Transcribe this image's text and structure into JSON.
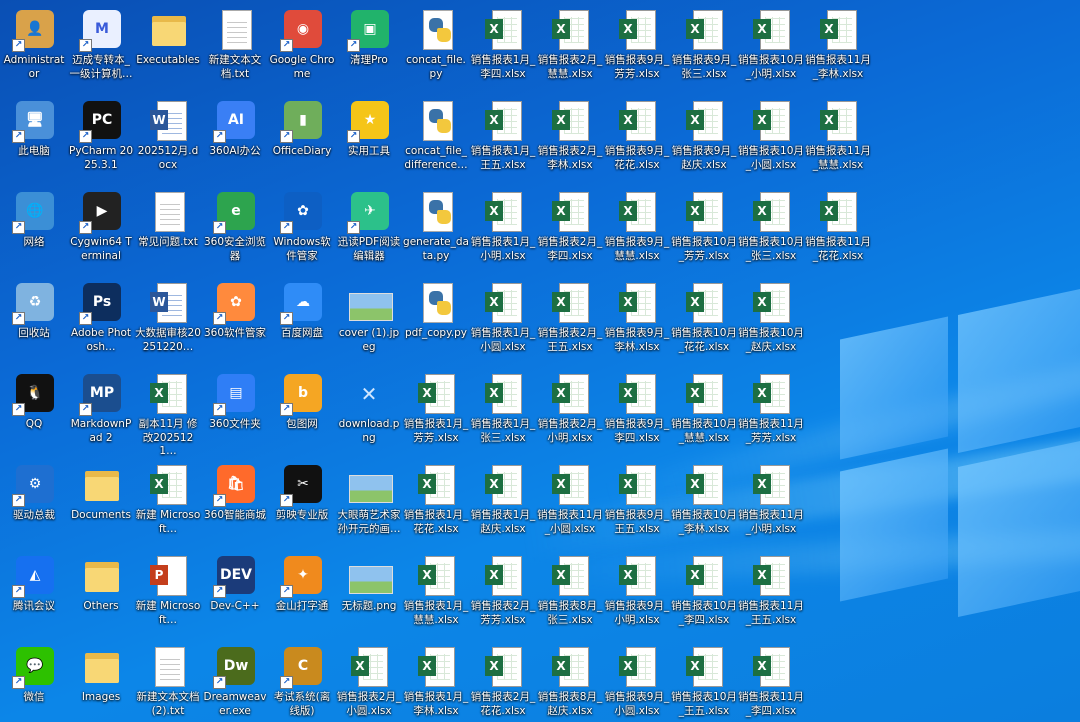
{
  "desktop": {
    "columns": [
      {
        "icons": [
          {
            "label": "Administrator",
            "kind": "user"
          },
          {
            "label": "此电脑",
            "kind": "pc"
          },
          {
            "label": "网络",
            "kind": "network"
          },
          {
            "label": "回收站",
            "kind": "recycle"
          },
          {
            "label": "QQ",
            "kind": "qq"
          },
          {
            "label": "驱动总裁",
            "kind": "driver"
          },
          {
            "label": "腾讯会议",
            "kind": "meeting"
          },
          {
            "label": "微信",
            "kind": "wechat"
          }
        ]
      },
      {
        "icons": [
          {
            "label": "迈成专转本_一级计算机…",
            "kind": "mc"
          },
          {
            "label": "PyCharm 2025.3.1",
            "kind": "pycharm"
          },
          {
            "label": "Cygwin64 Terminal",
            "kind": "terminal"
          },
          {
            "label": "Adobe Photosh…",
            "kind": "photoshop"
          },
          {
            "label": "MarkdownPad 2",
            "kind": "markdown"
          },
          {
            "label": "Documents",
            "kind": "folder"
          },
          {
            "label": "Others",
            "kind": "folder"
          },
          {
            "label": "Images",
            "kind": "folder"
          }
        ]
      },
      {
        "icons": [
          {
            "label": "Executables",
            "kind": "folder"
          },
          {
            "label": "202512月.docx",
            "kind": "word"
          },
          {
            "label": "常见问题.txt",
            "kind": "doc"
          },
          {
            "label": "大数据审核20251220…",
            "kind": "word"
          },
          {
            "label": "副本11月 修改2025121…",
            "kind": "excel"
          },
          {
            "label": "新建 Microsoft…",
            "kind": "excel"
          },
          {
            "label": "新建 Microsoft…",
            "kind": "ppt"
          },
          {
            "label": "新建文本文档 (2).txt",
            "kind": "doc"
          }
        ]
      },
      {
        "icons": [
          {
            "label": "新建文本文档.txt",
            "kind": "doc"
          },
          {
            "label": "360AI办公",
            "kind": "ai360"
          },
          {
            "label": "360安全浏览器",
            "kind": "browser360"
          },
          {
            "label": "360软件管家",
            "kind": "soft360"
          },
          {
            "label": "360文件夹",
            "kind": "folder360"
          },
          {
            "label": "360智能商城",
            "kind": "mall360"
          },
          {
            "label": "Dev-C++",
            "kind": "devcpp"
          },
          {
            "label": "Dreamweaver.exe",
            "kind": "dw"
          }
        ]
      },
      {
        "icons": [
          {
            "label": "Google Chrome",
            "kind": "chrome"
          },
          {
            "label": "OfficeDiary",
            "kind": "diary"
          },
          {
            "label": "Windows软件管家",
            "kind": "winsoft"
          },
          {
            "label": "百度网盘",
            "kind": "baidu"
          },
          {
            "label": "包图网",
            "kind": "baotu"
          },
          {
            "label": "剪映专业版",
            "kind": "capcut"
          },
          {
            "label": "金山打字通",
            "kind": "typing"
          },
          {
            "label": "考试系统(离线版)",
            "kind": "exam"
          }
        ]
      },
      {
        "icons": [
          {
            "label": "清理Pro",
            "kind": "cleaner"
          },
          {
            "label": "实用工具",
            "kind": "star"
          },
          {
            "label": "迅读PDF阅读编辑器",
            "kind": "pdfreader"
          },
          {
            "label": "cover (1).jpeg",
            "kind": "image"
          },
          {
            "label": "download.png",
            "kind": "broken"
          },
          {
            "label": "大眼萌艺术家孙开元的画…",
            "kind": "image"
          },
          {
            "label": "无标题.png",
            "kind": "image"
          },
          {
            "label": "销售报表2月_小圆.xlsx",
            "kind": "excel"
          }
        ]
      },
      {
        "icons": [
          {
            "label": "concat_file.py",
            "kind": "python"
          },
          {
            "label": "concat_file_difference…",
            "kind": "python"
          },
          {
            "label": "generate_data.py",
            "kind": "python"
          },
          {
            "label": "pdf_copy.py",
            "kind": "python"
          },
          {
            "label": "销售报表1月_芳芳.xlsx",
            "kind": "excel"
          },
          {
            "label": "销售报表1月_花花.xlsx",
            "kind": "excel"
          },
          {
            "label": "销售报表1月_慧慧.xlsx",
            "kind": "excel"
          },
          {
            "label": "销售报表1月_李林.xlsx",
            "kind": "excel"
          }
        ]
      },
      {
        "icons": [
          {
            "label": "销售报表1月_李四.xlsx",
            "kind": "excel"
          },
          {
            "label": "销售报表1月_王五.xlsx",
            "kind": "excel"
          },
          {
            "label": "销售报表1月_小明.xlsx",
            "kind": "excel"
          },
          {
            "label": "销售报表1月_小圆.xlsx",
            "kind": "excel"
          },
          {
            "label": "销售报表1月_张三.xlsx",
            "kind": "excel"
          },
          {
            "label": "销售报表1月_赵庆.xlsx",
            "kind": "excel"
          },
          {
            "label": "销售报表2月_芳芳.xlsx",
            "kind": "excel"
          },
          {
            "label": "销售报表2月_花花.xlsx",
            "kind": "excel"
          }
        ]
      },
      {
        "icons": [
          {
            "label": "销售报表2月_慧慧.xlsx",
            "kind": "excel"
          },
          {
            "label": "销售报表2月_李林.xlsx",
            "kind": "excel"
          },
          {
            "label": "销售报表2月_李四.xlsx",
            "kind": "excel"
          },
          {
            "label": "销售报表2月_王五.xlsx",
            "kind": "excel"
          },
          {
            "label": "销售报表2月_小明.xlsx",
            "kind": "excel"
          },
          {
            "label": "销售报表11月_小圆.xlsx",
            "kind": "excel"
          },
          {
            "label": "销售报表8月_张三.xlsx",
            "kind": "excel"
          },
          {
            "label": "销售报表8月_赵庆.xlsx",
            "kind": "excel"
          }
        ]
      },
      {
        "icons": [
          {
            "label": "销售报表9月_芳芳.xlsx",
            "kind": "excel"
          },
          {
            "label": "销售报表9月_花花.xlsx",
            "kind": "excel"
          },
          {
            "label": "销售报表9月_慧慧.xlsx",
            "kind": "excel"
          },
          {
            "label": "销售报表9月_李林.xlsx",
            "kind": "excel"
          },
          {
            "label": "销售报表9月_李四.xlsx",
            "kind": "excel"
          },
          {
            "label": "销售报表9月_王五.xlsx",
            "kind": "excel"
          },
          {
            "label": "销售报表9月_小明.xlsx",
            "kind": "excel"
          },
          {
            "label": "销售报表9月_小圆.xlsx",
            "kind": "excel"
          }
        ]
      },
      {
        "icons": [
          {
            "label": "销售报表9月_张三.xlsx",
            "kind": "excel"
          },
          {
            "label": "销售报表9月_赵庆.xlsx",
            "kind": "excel"
          },
          {
            "label": "销售报表10月_芳芳.xlsx",
            "kind": "excel"
          },
          {
            "label": "销售报表10月_花花.xlsx",
            "kind": "excel"
          },
          {
            "label": "销售报表10月_慧慧.xlsx",
            "kind": "excel"
          },
          {
            "label": "销售报表10月_李林.xlsx",
            "kind": "excel"
          },
          {
            "label": "销售报表10月_李四.xlsx",
            "kind": "excel"
          },
          {
            "label": "销售报表10月_王五.xlsx",
            "kind": "excel"
          }
        ]
      },
      {
        "icons": [
          {
            "label": "销售报表10月_小明.xlsx",
            "kind": "excel"
          },
          {
            "label": "销售报表10月_小圆.xlsx",
            "kind": "excel"
          },
          {
            "label": "销售报表10月_张三.xlsx",
            "kind": "excel"
          },
          {
            "label": "销售报表10月_赵庆.xlsx",
            "kind": "excel"
          },
          {
            "label": "销售报表11月_芳芳.xlsx",
            "kind": "excel"
          },
          {
            "label": "销售报表11月_小明.xlsx",
            "kind": "excel"
          },
          {
            "label": "销售报表11月_王五.xlsx",
            "kind": "excel"
          },
          {
            "label": "销售报表11月_李四.xlsx",
            "kind": "excel"
          }
        ]
      },
      {
        "icons": [
          {
            "label": "销售报表11月_李林.xlsx",
            "kind": "excel"
          },
          {
            "label": "销售报表11月_慧慧.xlsx",
            "kind": "excel"
          },
          {
            "label": "销售报表11月_花花.xlsx",
            "kind": "excel"
          }
        ]
      }
    ]
  },
  "colors": {
    "excel": "#1d6f42",
    "word": "#2b579a",
    "ppt": "#c43e1c",
    "folder": "#f8d775",
    "desktop_blue": "#0b6ad6"
  }
}
